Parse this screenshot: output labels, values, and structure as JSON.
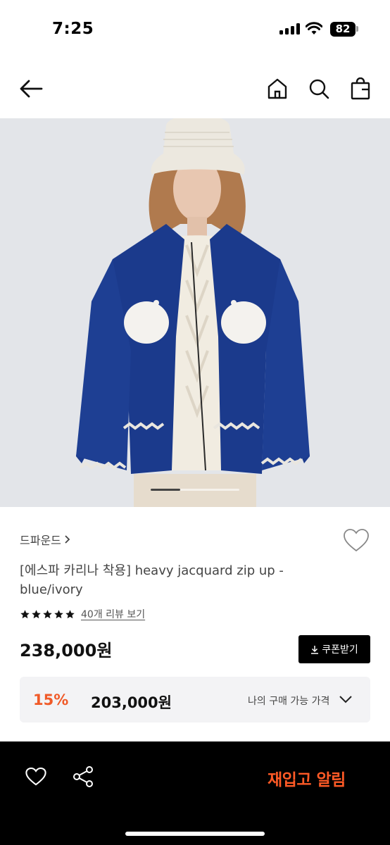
{
  "status_bar": {
    "time": "7:25",
    "battery": "82"
  },
  "nav": {
    "back_icon": "arrow-left-icon",
    "home_icon": "home-icon",
    "search_icon": "search-icon",
    "bag_icon": "shopping-bag-icon"
  },
  "hero": {
    "page_index": 1,
    "page_count": 3
  },
  "product": {
    "brand": "드파운드",
    "brand_chevron": "›",
    "title": "[에스파 카리나 착용] heavy jacquard zip up - blue/ivory",
    "rating_stars": 5,
    "review_link": "40개 리뷰 보기",
    "price": "238,000원",
    "coupon_label": "쿠폰받기",
    "discount": {
      "rate": "15%",
      "price": "203,000원",
      "label": "나의 구매 가능 가격"
    }
  },
  "bottom_bar": {
    "wish_icon": "heart-icon",
    "share_icon": "share-icon",
    "restock_label": "재입고 알림"
  },
  "colors": {
    "accent": "#f05a28",
    "restock": "#ff5a26",
    "bottom_bar_bg": "#000000",
    "cardigan_blue": "#1b3a8c"
  }
}
